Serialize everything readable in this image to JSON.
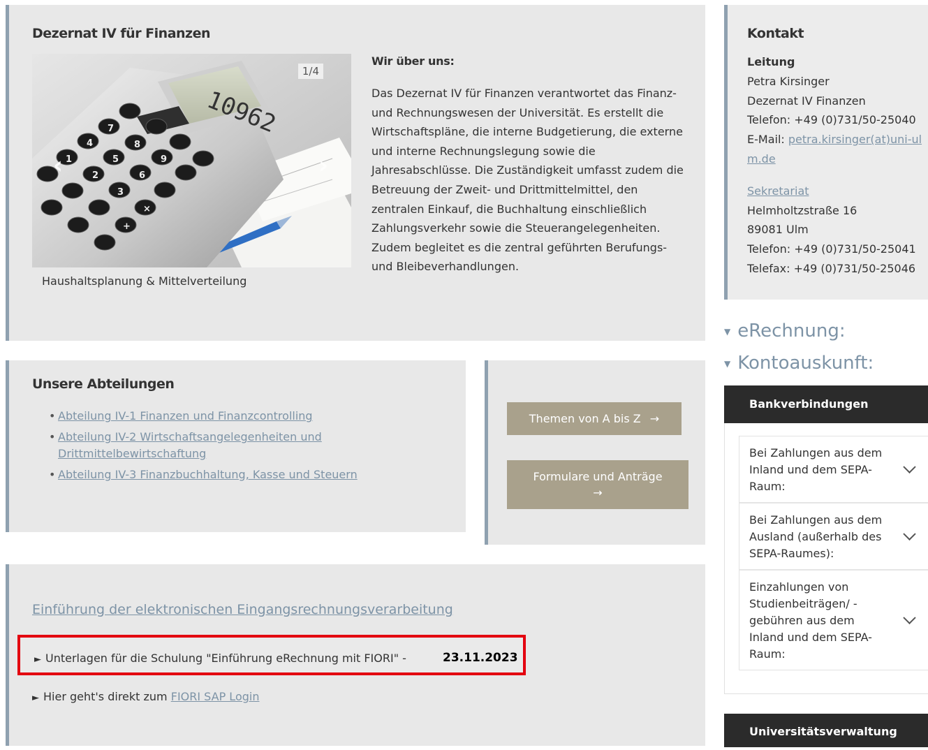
{
  "main": {
    "title": "Dezernat IV für Finanzen",
    "slider": {
      "counter": "1/4",
      "display_value": "10962",
      "caption": "Haushaltsplanung & Mittelverteilung"
    },
    "about": {
      "heading": "Wir über uns:",
      "text": "Das Dezernat IV für Finanzen verantwortet das Finanz- und Rechnungswesen der Universität. Es erstellt die Wirtschaftspläne, die interne Budgetierung, die externe und interne Rechnungslegung sowie die Jahresabschlüsse. Die Zuständigkeit umfasst zudem die Betreuung der Zweit- und Drittmittelmittel, den zentralen Einkauf, die Buchhaltung einschließlich Zahlungsverkehr sowie die Steuerangelegenheiten. Zudem begleitet es die zentral geführten Berufungs- und Bleibeverhandlungen."
    }
  },
  "departments": {
    "title": "Unsere Abteilungen",
    "items": [
      "Abteilung IV-1 Finanzen und Finanzcontrolling",
      "Abteilung IV-2 Wirtschaftsangelegenheiten und Drittmittelbewirtschaftung",
      "Abteilung IV-3 Finanzbuchhaltung, Kasse und Steuern"
    ]
  },
  "buttons": {
    "themen": "Themen von A bis Z",
    "formulare": "Formulare und Anträge",
    "arrow": "→"
  },
  "erechnung": {
    "intro_link": "Einführung der elektronischen Eingangsrechnungsverarbeitung",
    "row1_text": "Unterlagen für die Schulung \"Einführung eRechnung mit FIORI\" -",
    "row1_date": "23.11.2023",
    "row2_text": "Hier geht's direkt zum",
    "row2_link": "FIORI SAP Login",
    "bullet": "►"
  },
  "contact": {
    "title": "Kontakt",
    "leitung_label": "Leitung",
    "name": "Petra Kirsinger",
    "unit": "Dezernat IV Finanzen",
    "phone": "Telefon: +49 (0)731/50-25040",
    "email_label": "E-Mail:",
    "email": "petra.kirsinger(at)uni-ulm.de",
    "sekretariat": "Sekretariat",
    "street": "Helmholtzstraße 16",
    "city": "89081 Ulm",
    "phone2": "Telefon: +49 (0)731/50-25041",
    "fax": "Telefax: +49 (0)731/50-25046"
  },
  "sidebar": {
    "accordion": [
      "eRechnung:",
      "Kontoauskunft:"
    ],
    "bank_title": "Bankverbindungen",
    "bank_items": [
      "Bei Zahlungen aus dem Inland und dem SEPA-Raum:",
      "Bei Zahlungen aus dem Ausland (außerhalb des SEPA-Raumes):",
      "Einzahlungen von Studienbeiträgen/ -gebühren aus dem Inland und dem SEPA-Raum:"
    ],
    "uni_title": "Universitätsverwaltung"
  },
  "colors": {
    "accent_link": "#7d93a6",
    "button": "#a9a18c",
    "panel_bg": "#e8e8e8",
    "panel_border": "#8fa1b0",
    "dark_bar": "#2b2b2b",
    "highlight": "#e3000f"
  }
}
